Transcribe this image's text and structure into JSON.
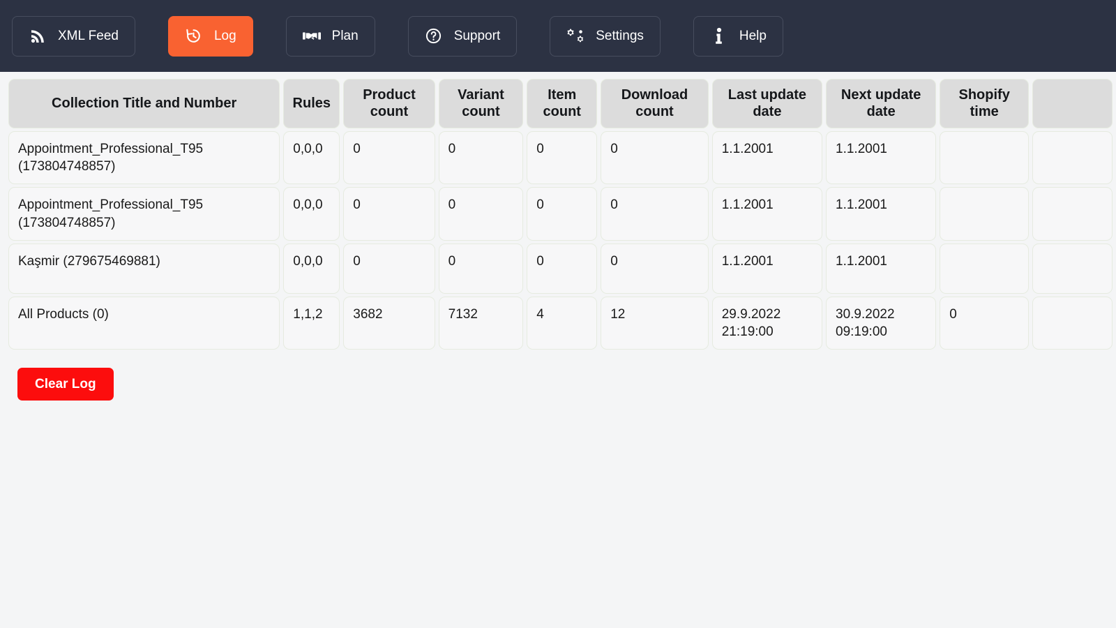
{
  "nav": {
    "items": [
      {
        "label": "XML Feed",
        "icon": "rss-icon",
        "active": false
      },
      {
        "label": "Log",
        "icon": "history-icon",
        "active": true
      },
      {
        "label": "Plan",
        "icon": "handshake-icon",
        "active": false
      },
      {
        "label": "Support",
        "icon": "question-circle-icon",
        "active": false
      },
      {
        "label": "Settings",
        "icon": "gears-icon",
        "active": false
      },
      {
        "label": "Help",
        "icon": "info-icon",
        "active": false
      }
    ],
    "active_color": "#f96231",
    "bar_color": "#2c3243"
  },
  "table": {
    "columns": [
      "Collection Title and Number",
      "Rules",
      "Product count",
      "Variant count",
      "Item count",
      "Download count",
      "Last update date",
      "Next update date",
      "Shopify time"
    ],
    "rows": [
      {
        "title": "Appointment_Professional_T95 (173804748857)",
        "rules": "0,0,0",
        "product_count": "0",
        "variant_count": "0",
        "item_count": "0",
        "download_count": "0",
        "last_update": "1.1.2001",
        "next_update": "1.1.2001",
        "shopify_time": "",
        "extra": ""
      },
      {
        "title": "Appointment_Professional_T95 (173804748857)",
        "rules": "0,0,0",
        "product_count": "0",
        "variant_count": "0",
        "item_count": "0",
        "download_count": "0",
        "last_update": "1.1.2001",
        "next_update": "1.1.2001",
        "shopify_time": "",
        "extra": ""
      },
      {
        "title": "Kaşmir (279675469881)",
        "rules": "0,0,0",
        "product_count": "0",
        "variant_count": "0",
        "item_count": "0",
        "download_count": "0",
        "last_update": "1.1.2001",
        "next_update": "1.1.2001",
        "shopify_time": "",
        "extra": ""
      },
      {
        "title": "All Products (0)",
        "rules": "1,1,2",
        "product_count": "3682",
        "variant_count": "7132",
        "item_count": "4",
        "download_count": "12",
        "last_update": "29.9.2022 21:19:00",
        "next_update": "30.9.2022 09:19:00",
        "shopify_time": "0",
        "extra": ""
      }
    ]
  },
  "actions": {
    "clear_log_label": "Clear Log",
    "clear_log_color": "#fc0d0d"
  }
}
